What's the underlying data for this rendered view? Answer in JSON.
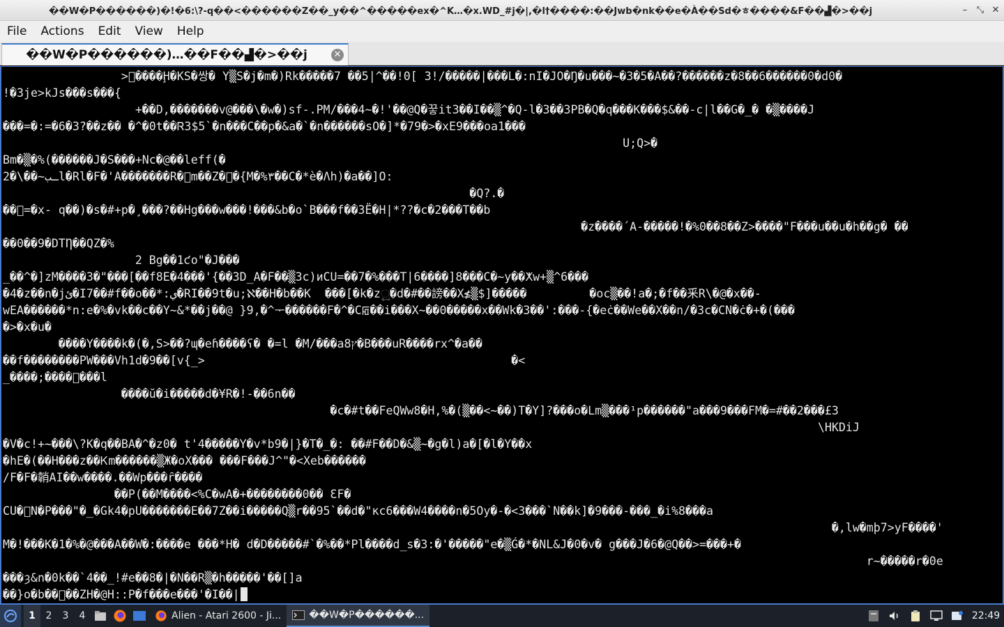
{
  "window": {
    "title": "��W�P������)�!�6:\\?-q��<������Z��_y��^�����ex�^K…�x.WD_#j�|,�l†����:��Jwb�nk��e�À��Sd�ㅎ����&F��▟�>��j",
    "controls": {
      "minimize": "–",
      "maximize": "⤡",
      "close": "✕"
    }
  },
  "menu": [
    "File",
    "Actions",
    "Edit",
    "View",
    "Help"
  ],
  "tab": {
    "label": "��W�P������)…��F��▟�>��j",
    "close": "✕"
  },
  "terminal": {
    "lines": [
      "                 >￿����Ḩ�KS�쌍� Y▒S�j�m�)Rk�����7 ��5|^��!0[ 3!/�����|���L�:nI�JO�Ŋ�u���~�3�5�A��?������z�8��6������0�d0�",
      "!�3je>kJs���s���{",
      "                   +��D,�������v@���\\�w�)sf-.PM/���4~�!'��@Q�끟it3��I��▒^�Q-l�3��3PB�Q�q���K���$&��-c|l��G�_� �▒����J",
      "���=�:=�6�3?��z�� �^�0t��Ꮢ3$5`�n���C��p�&a�`�n������sO�]*�79�>�xE9���oa1���",
      "                                                                                         U;Q>�",
      "Bm�▒�%(������J�S���+Nc�@��leff(�",
      "2�\\��~ـبl�Rl�F�'A�������R�￿m��Z�￿�{M�%٣��C�*è�Λh)�a��]O:",
      "                                                                   �Q?.�",
      "��￿=�x- q��)�s�#+p�¸���?��Hg���w���!���&b�o`B���f��3Ë�H|*??�c�2���T��b",
      "                                                                                   �z����´A-�����!�%0��8��Z>����\"F���u��u�h��g� ��",
      "��0��9�DTȠ��QZ�%",
      "                   2 Bg��1ƈo\"�J���",
      "_��^�]zM����3�\"���[��f8E�4���'{��3D_A�F��▒3c)иCU=��7�%���T|6����]8���C�~y��ⵅw+▒^6���",
      "�4�z��n�jئ�I7��#f��o��*:ي�RI��9t�u;ℵ��H�b��K  ���[�k�zූ�d�#��謗��X≰▒$]�����         �oc▒��!a�;�f��釆R\\�@�x��-",
      "wEA������*n:e�%�vk��c��Y~&*��j��@ }9,�^ᅮ������F�^�Cꡂ��i���X~��0�����x��Wk�3��':���-{�eċ��We��X��n/�3c�CN�ċ�+�(���",
      "�>�x�u�",
      "        ����Y����k�(�,S>��?ɰ�eɦ����ʕ� �=l �M/���a8ץ�B���uR����rx^�a��",
      "��f��������PW���Vh1d�9��[v{_>                                            �<",
      "_����;����￿���l",
      "                 ����ŭ�i�����d�¥R�!-��6n��",
      "                                               �c�#t��FeQWw8�H,%�(▒��<~��)T�Y]?���o�Lm▒���¹p������\"a���9���FM�=#��2���£3",
      "                                                                                                                     \\HKDiJ",
      "�V�c!+~���\\?K�q��BA�^�z0� t'4�����Y�v*b9�|}�T�_�: ��#F��D�&▒~�g�l)a�[�l�Y��x",
      "�hE�(��H���z��Ꮶm������▒Ж�oX��� ���F���J^\"�<Xeb������",
      "/F�F�韒AI��w����.��Wp���ȓ����",
      "                ��P(��M����<%C�wA�+��������0�� ƐF�",
      "CU�￿N�P���\"�_�Gk4�pU�������E��7Z��i�����Q▒r��95`��d�\"κc6���W4����n�5Oy�-�<3���`N��k]�9���-���_�i%8���a",
      "                                                                                                                       �,lw�mþ7>yF����'",
      "M�!���K�1�%�@���A��W�:����e ���*H� d�D�����#`�%��*Pl����d_s�3:�'�����\"e�▒Ǵ�*�NL&J�0�v� g���J�6�@Q��>=���+�",
      "                                                                                                                            r~�����r�0e",
      "���ȝ&n�0k��`4��_!#e��8�|�N��R▒�h�����'��[]a",
      "��}o�b��￿��ZH�@H::P�f���e���'�I��|"
    ]
  },
  "taskbar": {
    "workspaces": [
      "1",
      "2",
      "3",
      "4"
    ],
    "tasks": [
      {
        "label": "Alien - Atari 2600 - Ji..."
      },
      {
        "label": "��W�P������..."
      }
    ],
    "clock": "22:49"
  },
  "colors": {
    "terminal_bg": "#000000",
    "terminal_fg": "#e6e6e6",
    "accent": "#4a7bd0",
    "taskbar_bg": "#1c2129"
  }
}
